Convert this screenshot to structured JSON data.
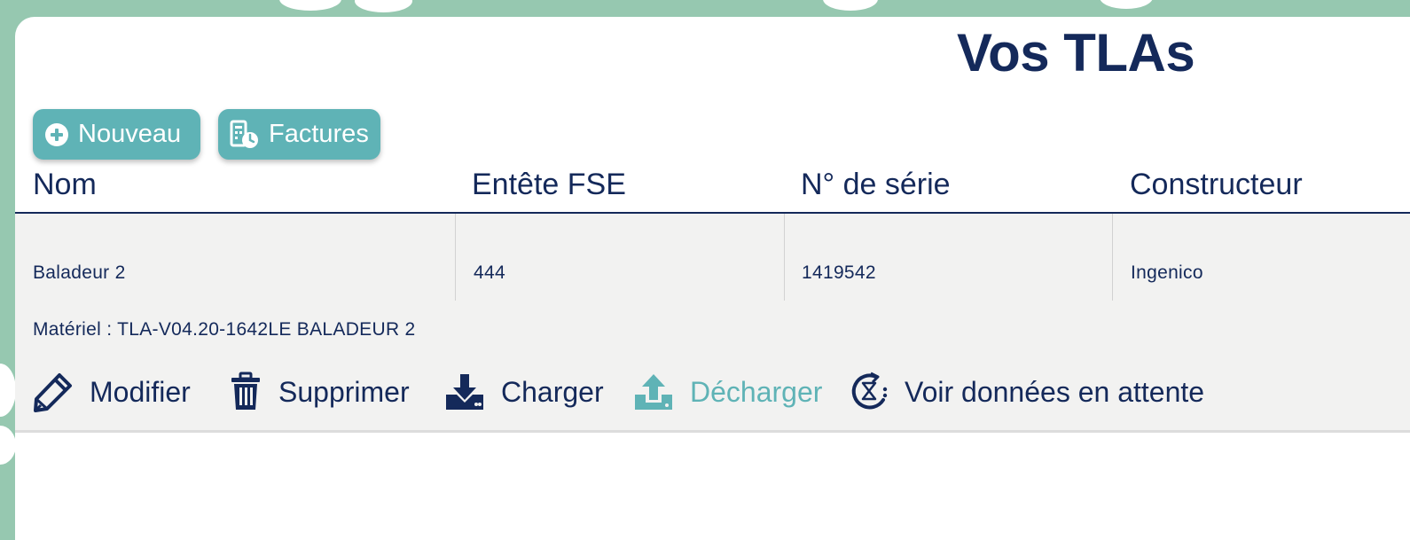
{
  "page": {
    "title": "Vos TLAs"
  },
  "toolbar": {
    "new_label": "Nouveau",
    "invoices_label": "Factures"
  },
  "table": {
    "columns": [
      "Nom",
      "Entête FSE",
      "N° de série",
      "Constructeur"
    ],
    "rows": [
      {
        "name": "Baladeur 2",
        "fse_header": "444",
        "serial": "1419542",
        "manufacturer": "Ingenico",
        "materiel": "Matériel : TLA-V04.20-1642LE BALADEUR 2"
      }
    ]
  },
  "actions": {
    "edit": "Modifier",
    "delete": "Supprimer",
    "load": "Charger",
    "unload": "Décharger",
    "pending": "Voir données en attente"
  },
  "icons": {
    "new": "plus-circle-icon",
    "invoices": "invoice-clock-icon",
    "edit": "pencil-icon",
    "delete": "trash-icon",
    "load": "download-icon",
    "unload": "upload-icon",
    "pending": "history-hourglass-icon"
  },
  "colors": {
    "primary_text": "#14295a",
    "accent": "#5fb3b6",
    "background": "#96c8b0",
    "row_background": "#f2f2f1"
  }
}
